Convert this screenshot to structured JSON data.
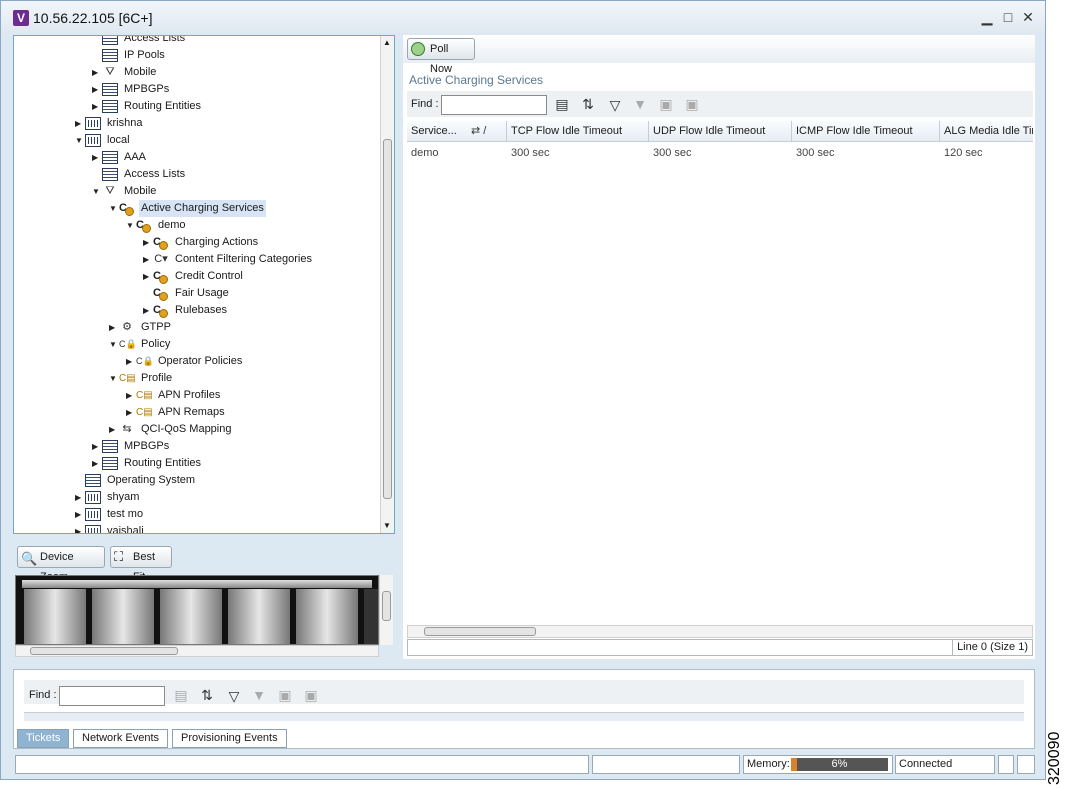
{
  "window": {
    "title": "10.56.22.105 [6C+]",
    "logo": "V",
    "minimize": "▁",
    "maximize": "□",
    "close": "✕"
  },
  "tree": [
    {
      "label": "Access Lists",
      "depth": 3,
      "icon": "grid-icon",
      "exp": ""
    },
    {
      "label": "IP Pools",
      "depth": 3,
      "icon": "grid-icon",
      "exp": ""
    },
    {
      "label": "Mobile",
      "depth": 3,
      "icon": "mobile-icon",
      "exp": "▶"
    },
    {
      "label": "MPBGPs",
      "depth": 3,
      "icon": "grid-icon",
      "exp": "▶"
    },
    {
      "label": "Routing Entities",
      "depth": 3,
      "icon": "grid-icon",
      "exp": "▶"
    },
    {
      "label": "krishna",
      "depth": 2,
      "icon": "node-icon",
      "exp": "▶"
    },
    {
      "label": "local",
      "depth": 2,
      "icon": "node-icon",
      "exp": "▼"
    },
    {
      "label": "AAA",
      "depth": 3,
      "icon": "grid-icon",
      "exp": "▶"
    },
    {
      "label": "Access Lists",
      "depth": 3,
      "icon": "grid-icon",
      "exp": ""
    },
    {
      "label": "Mobile",
      "depth": 3,
      "icon": "mobile-icon",
      "exp": "▼"
    },
    {
      "label": "Active Charging Services",
      "depth": 4,
      "icon": "charging-service-icon",
      "exp": "▼",
      "selected": true
    },
    {
      "label": "demo",
      "depth": 5,
      "icon": "charging-service-icon",
      "exp": "▼"
    },
    {
      "label": "Charging Actions",
      "depth": 6,
      "icon": "charging-service-icon",
      "exp": "▶"
    },
    {
      "label": "Content Filtering Categories",
      "depth": 6,
      "icon": "filter-icon",
      "exp": "▶"
    },
    {
      "label": "Credit Control",
      "depth": 6,
      "icon": "charging-service-icon",
      "exp": "▶"
    },
    {
      "label": "Fair Usage",
      "depth": 6,
      "icon": "charging-service-icon",
      "exp": ""
    },
    {
      "label": "Rulebases",
      "depth": 6,
      "icon": "charging-service-icon",
      "exp": "▶"
    },
    {
      "label": "GTPP",
      "depth": 4,
      "icon": "gtpp-icon",
      "exp": "▶"
    },
    {
      "label": "Policy",
      "depth": 4,
      "icon": "lock-icon",
      "exp": "▼"
    },
    {
      "label": "Operator Policies",
      "depth": 5,
      "icon": "lock-icon",
      "exp": "▶"
    },
    {
      "label": "Profile",
      "depth": 4,
      "icon": "profile-icon",
      "exp": "▼"
    },
    {
      "label": "APN Profiles",
      "depth": 5,
      "icon": "profile-icon",
      "exp": "▶"
    },
    {
      "label": "APN Remaps",
      "depth": 5,
      "icon": "profile-icon",
      "exp": "▶"
    },
    {
      "label": "QCI-QoS Mapping",
      "depth": 4,
      "icon": "qos-icon",
      "exp": "▶"
    },
    {
      "label": "MPBGPs",
      "depth": 3,
      "icon": "grid-icon",
      "exp": "▶"
    },
    {
      "label": "Routing Entities",
      "depth": 3,
      "icon": "grid-icon",
      "exp": "▶"
    },
    {
      "label": "Operating System",
      "depth": 2,
      "icon": "grid-icon",
      "exp": ""
    },
    {
      "label": "shyam",
      "depth": 2,
      "icon": "node-icon",
      "exp": "▶"
    },
    {
      "label": "test mo",
      "depth": 2,
      "icon": "node-icon",
      "exp": "▶"
    },
    {
      "label": "vaishali",
      "depth": 2,
      "icon": "node-icon",
      "exp": "▶"
    }
  ],
  "zoom": {
    "device_zoom": "Device Zoom",
    "best_fit": "Best Fit"
  },
  "main": {
    "poll_now": "Poll Now",
    "section_title": "Active Charging Services",
    "find_label": "Find :",
    "find_value": "",
    "columns": [
      "Service...",
      "TCP Flow Idle Timeout",
      "UDP Flow Idle Timeout",
      "ICMP Flow Idle Timeout",
      "ALG Media Idle Tim"
    ],
    "rows": [
      [
        "demo",
        "300 sec",
        "300 sec",
        "300 sec",
        "120 sec"
      ]
    ],
    "line_status": "Line 0 (Size 1)"
  },
  "bottom": {
    "find_label": "Find :",
    "find_value": "",
    "tabs": [
      "Tickets",
      "Network Events",
      "Provisioning Events"
    ],
    "active_tab": 0
  },
  "status": {
    "memory_label": "Memory:",
    "memory_percent": "6%",
    "memory_fraction": 0.06,
    "connection": "Connected"
  },
  "side_label": "320090"
}
